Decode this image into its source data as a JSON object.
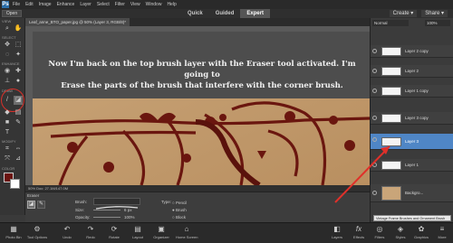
{
  "app": {
    "logo": "Ps"
  },
  "menu": [
    "File",
    "Edit",
    "Image",
    "Enhance",
    "Layer",
    "Select",
    "Filter",
    "View",
    "Window",
    "Help"
  ],
  "header": {
    "open_label": "Open",
    "modes": [
      "Quick",
      "Guided",
      "Expert"
    ],
    "active_mode": "Expert",
    "create_label": "Create ▾",
    "share_label": "Share ▾"
  },
  "document_tab": "Leaf_anne_BTO_paper.jpg @ 50% (Layer 3, RGB/8)*",
  "toolbox": {
    "view": "VIEW",
    "select": "SELECT",
    "enhance": "ENHANCE",
    "draw": "DRAW",
    "modify": "MODIFY",
    "color": "COLOR"
  },
  "caption": {
    "line1": "Now I'm back on the top brush layer with the Eraser tool activated. I'm going to",
    "line2": "Erase the parts of the brush that interfere with the corner brush."
  },
  "status": "50%    Doc: 27.1M/147.0M",
  "options": {
    "tool_name": "Eraser",
    "brush_label": "Brush:",
    "size_label": "Size:",
    "size_value": "6 px",
    "opacity_label": "Opacity:",
    "opacity_value": "100%",
    "type_label": "Type:",
    "type_options": [
      "Pencil",
      "Brush",
      "Block"
    ]
  },
  "layers": {
    "blend_mode": "Normal",
    "opacity": "100%",
    "items": [
      {
        "name": "Layer 2 copy"
      },
      {
        "name": "Layer 2"
      },
      {
        "name": "Layer 1 copy"
      },
      {
        "name": "Layer 3 copy"
      },
      {
        "name": "Layer 3"
      },
      {
        "name": "Layer 1"
      },
      {
        "name": "Backgro..."
      }
    ]
  },
  "tooltip": "Vintage Frame Brushes and Ornament Brush Pack",
  "bottom_bar": [
    {
      "label": "Photo Bin",
      "icon": "photo-bin-icon",
      "glyph": "▦"
    },
    {
      "label": "Tool Options",
      "icon": "tool-options-icon",
      "glyph": "⚙"
    },
    {
      "label": "Undo",
      "icon": "undo-icon",
      "glyph": "↶"
    },
    {
      "label": "Redo",
      "icon": "redo-icon",
      "glyph": "↷"
    },
    {
      "label": "Rotate",
      "icon": "rotate-icon",
      "glyph": "⟳"
    },
    {
      "label": "Layout",
      "icon": "layout-icon",
      "glyph": "▤"
    },
    {
      "label": "Organizer",
      "icon": "organizer-icon",
      "glyph": "▣"
    },
    {
      "label": "Home Screen",
      "icon": "home-icon",
      "glyph": "⌂"
    },
    {
      "label": "Layers",
      "icon": "layers-icon",
      "glyph": "◧"
    },
    {
      "label": "Effects",
      "icon": "effects-icon",
      "glyph": "fx"
    },
    {
      "label": "Filters",
      "icon": "filters-icon",
      "glyph": "◎"
    },
    {
      "label": "Styles",
      "icon": "styles-icon",
      "glyph": "◈"
    },
    {
      "label": "Graphics",
      "icon": "graphics-icon",
      "glyph": "✿"
    },
    {
      "label": "More",
      "icon": "more-icon",
      "glyph": "≡"
    }
  ]
}
